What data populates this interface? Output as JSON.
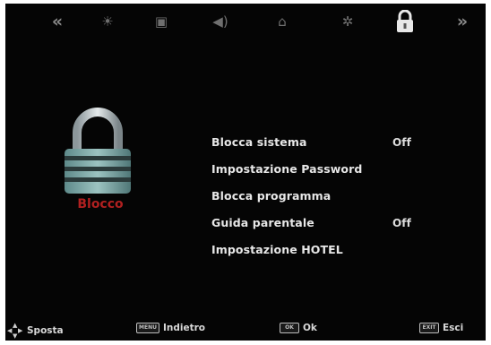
{
  "top_tabs": [
    {
      "name": "nav-prev-icon",
      "glyph": "«"
    },
    {
      "name": "picture-icon",
      "glyph": "☀"
    },
    {
      "name": "channel-icon",
      "glyph": "▣"
    },
    {
      "name": "sound-icon",
      "glyph": "◀)"
    },
    {
      "name": "time-icon",
      "glyph": "⌂"
    },
    {
      "name": "setup-icon",
      "glyph": "✲"
    },
    {
      "name": "lock-icon",
      "glyph": "🔒"
    },
    {
      "name": "nav-next-icon",
      "glyph": "»"
    }
  ],
  "section": {
    "title": "Blocco"
  },
  "menu": [
    {
      "label": "Blocca sistema",
      "value": "Off"
    },
    {
      "label": "Impostazione Password",
      "value": ""
    },
    {
      "label": "Blocca programma",
      "value": ""
    },
    {
      "label": "Guida parentale",
      "value": "Off"
    },
    {
      "label": "Impostazione HOTEL",
      "value": ""
    }
  ],
  "footer": {
    "move_label": "Sposta",
    "back_key": "MENU",
    "back_label": "Indietro",
    "ok_key": "OK",
    "ok_label": "Ok",
    "exit_key": "EXIT",
    "exit_label": "Esci"
  },
  "colors": {
    "accent_red": "#b02020",
    "background": "#050505",
    "text": "#e7e7e7"
  }
}
